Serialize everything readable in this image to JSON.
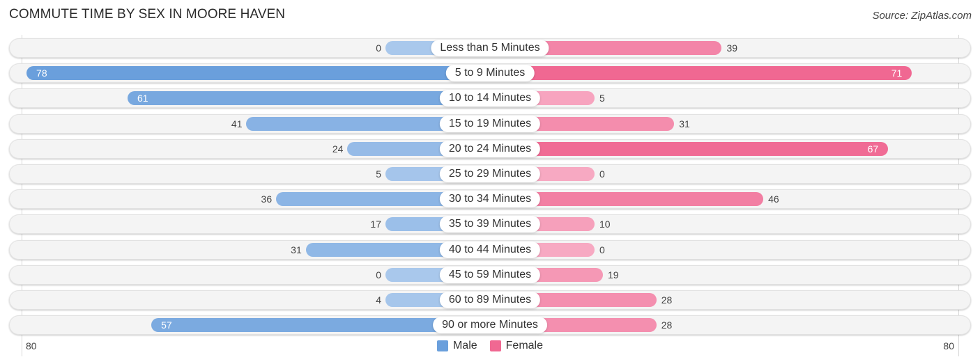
{
  "header": {
    "title": "COMMUTE TIME BY SEX IN MOORE HAVEN",
    "source": "Source: ZipAtlas.com"
  },
  "colors": {
    "male": "#6a9fdc",
    "male_light": "#a9c8ec",
    "female": "#f06892",
    "female_light": "#f7a9c2"
  },
  "legend": [
    {
      "label": "Male",
      "color": "#6a9fdc"
    },
    {
      "label": "Female",
      "color": "#f06892"
    }
  ],
  "axis": {
    "left_label": "80",
    "right_label": "80"
  },
  "chart_data": {
    "type": "bar",
    "orientation": "horizontal-diverging",
    "title": "COMMUTE TIME BY SEX IN MOORE HAVEN",
    "categories": [
      "Less than 5 Minutes",
      "5 to 9 Minutes",
      "10 to 14 Minutes",
      "15 to 19 Minutes",
      "20 to 24 Minutes",
      "25 to 29 Minutes",
      "30 to 34 Minutes",
      "35 to 39 Minutes",
      "40 to 44 Minutes",
      "45 to 59 Minutes",
      "60 to 89 Minutes",
      "90 or more Minutes"
    ],
    "series": [
      {
        "name": "Male",
        "values": [
          0,
          78,
          61,
          41,
          24,
          5,
          36,
          17,
          31,
          0,
          4,
          57
        ]
      },
      {
        "name": "Female",
        "values": [
          39,
          71,
          5,
          31,
          67,
          0,
          46,
          10,
          0,
          19,
          28,
          28
        ]
      }
    ],
    "xlim": [
      -80,
      80
    ],
    "xlabel": "",
    "ylabel": "",
    "legend_position": "bottom-center",
    "grid": false
  }
}
